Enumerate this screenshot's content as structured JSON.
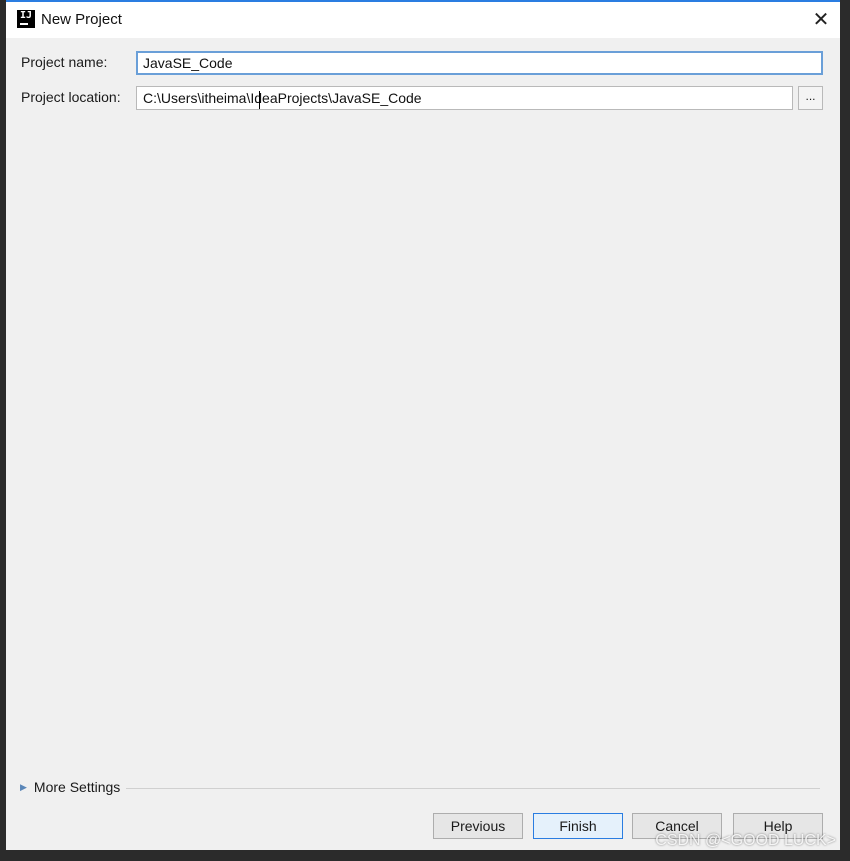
{
  "window": {
    "title": "New Project",
    "close_glyph": "✕",
    "app_icon": "intellij-idea-icon"
  },
  "form": {
    "name_label": "Project name:",
    "name_value": "JavaSE_Code",
    "location_label": "Project location:",
    "location_value": "C:\\Users\\itheima\\IdeaProjects\\JavaSE_Code",
    "browse_label": "..."
  },
  "more_settings": {
    "label": "More Settings",
    "expanded": false
  },
  "buttons": {
    "previous": "Previous",
    "finish": "Finish",
    "cancel": "Cancel",
    "help": "Help"
  },
  "watermark": "CSDN @<GOOD LUCK>",
  "colors": {
    "accent": "#2a7de1",
    "focus_border": "#6a9fd8",
    "background": "#f0f0f0"
  }
}
